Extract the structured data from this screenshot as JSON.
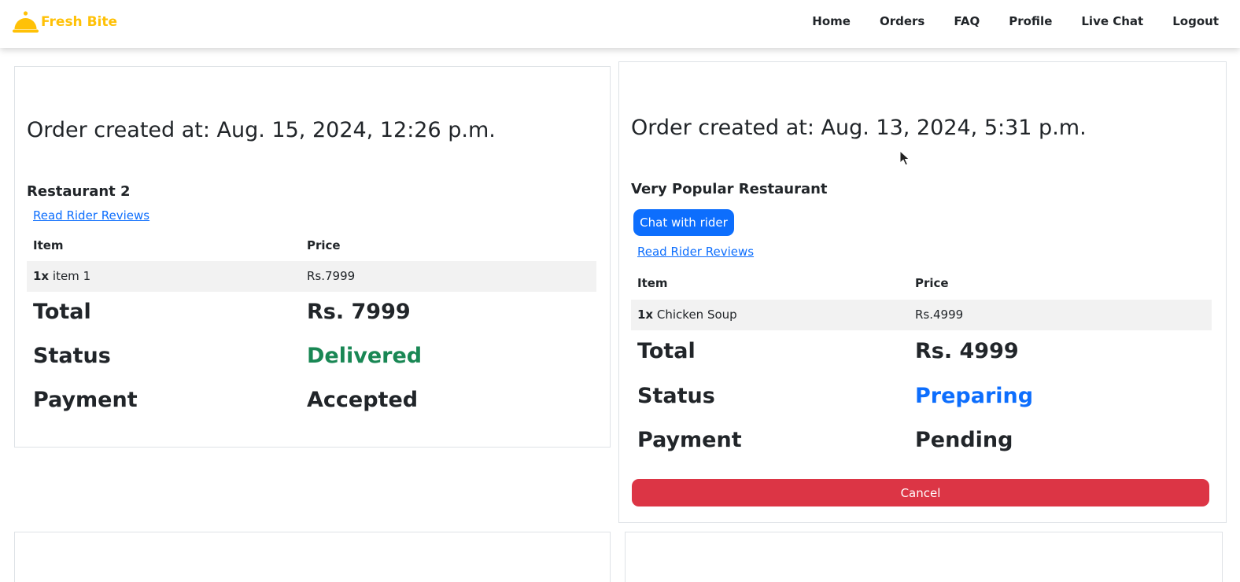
{
  "brand": {
    "name": "Fresh Bite",
    "icon": "cloche-icon",
    "color": "#ffc107"
  },
  "nav": [
    {
      "label": "Home"
    },
    {
      "label": "Orders"
    },
    {
      "label": "FAQ"
    },
    {
      "label": "Profile"
    },
    {
      "label": "Live Chat"
    },
    {
      "label": "Logout"
    }
  ],
  "orders": [
    {
      "created": "Order created at: Aug. 15, 2024, 12:26 p.m.",
      "restaurant": "Restaurant 2",
      "reviews_link": "Read Rider Reviews",
      "table_headers": {
        "item": "Item",
        "price": "Price"
      },
      "items": [
        {
          "qty": "1x",
          "name": "item 1",
          "price": "Rs.7999"
        }
      ],
      "total_label": "Total",
      "total_value": "Rs. 7999",
      "status_label": "Status",
      "status_value": "Delivered",
      "payment_label": "Payment",
      "payment_value": "Accepted"
    },
    {
      "created": "Order created at: Aug. 13, 2024, 5:31 p.m.",
      "restaurant": "Very Popular Restaurant",
      "chat_button": "Chat with rider",
      "reviews_link": "Read Rider Reviews",
      "table_headers": {
        "item": "Item",
        "price": "Price"
      },
      "items": [
        {
          "qty": "1x",
          "name": "Chicken Soup",
          "price": "Rs.4999"
        }
      ],
      "total_label": "Total",
      "total_value": "Rs. 4999",
      "status_label": "Status",
      "status_value": "Preparing",
      "payment_label": "Payment",
      "payment_value": "Pending",
      "cancel_button": "Cancel"
    }
  ],
  "colors": {
    "delivered": "#198754",
    "preparing": "#0d6efd",
    "primary": "#0d6efd",
    "danger": "#dc3545"
  }
}
